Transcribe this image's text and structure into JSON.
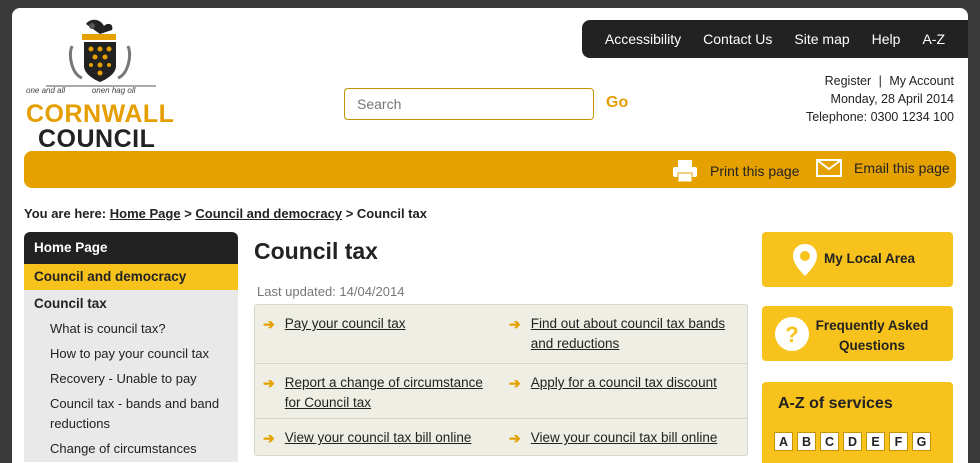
{
  "logo": {
    "motto_left": "one and all",
    "motto_right": "onen hag oll",
    "line1": "CORNWALL",
    "line2": "COUNCIL"
  },
  "topnav": [
    "Accessibility",
    "Contact Us",
    "Site map",
    "Help",
    "A-Z"
  ],
  "search": {
    "placeholder": "Search",
    "go": "Go"
  },
  "account": {
    "register": "Register",
    "separator": "|",
    "my_account": "My Account",
    "date": "Monday, 28 April 2014",
    "telephone": "Telephone: 0300 1234 100"
  },
  "banner": {
    "print": "Print this page",
    "email": "Email this page"
  },
  "breadcrumb": {
    "prefix": "You are here:",
    "items": [
      "Home Page",
      "Council and democracy"
    ],
    "sep": ">",
    "current": "Council tax"
  },
  "leftnav": {
    "home": "Home Page",
    "council": "Council and democracy",
    "tax": "Council tax",
    "sub": [
      "What is council tax?",
      "How to pay your council tax",
      "Recovery - Unable to pay",
      "Council tax - bands and band reductions",
      "Change of circumstances"
    ]
  },
  "main": {
    "title": "Council tax",
    "updated": "Last updated: 14/04/2014",
    "links": [
      [
        "Pay your council tax",
        "Find out about council tax bands and reductions"
      ],
      [
        "Report a change of circumstance for Council tax",
        "Apply for a council tax discount"
      ],
      [
        "View your council tax bill online",
        "View your council tax bill online"
      ]
    ]
  },
  "right": {
    "local_area": "My Local Area",
    "faq": "Frequently Asked Questions",
    "az_title": "A-Z of services",
    "az_letters": [
      "A",
      "B",
      "C",
      "D",
      "E",
      "F",
      "G"
    ]
  },
  "colors": {
    "accent": "#e5a100",
    "panel": "#f6c21b",
    "dark": "#222222"
  }
}
